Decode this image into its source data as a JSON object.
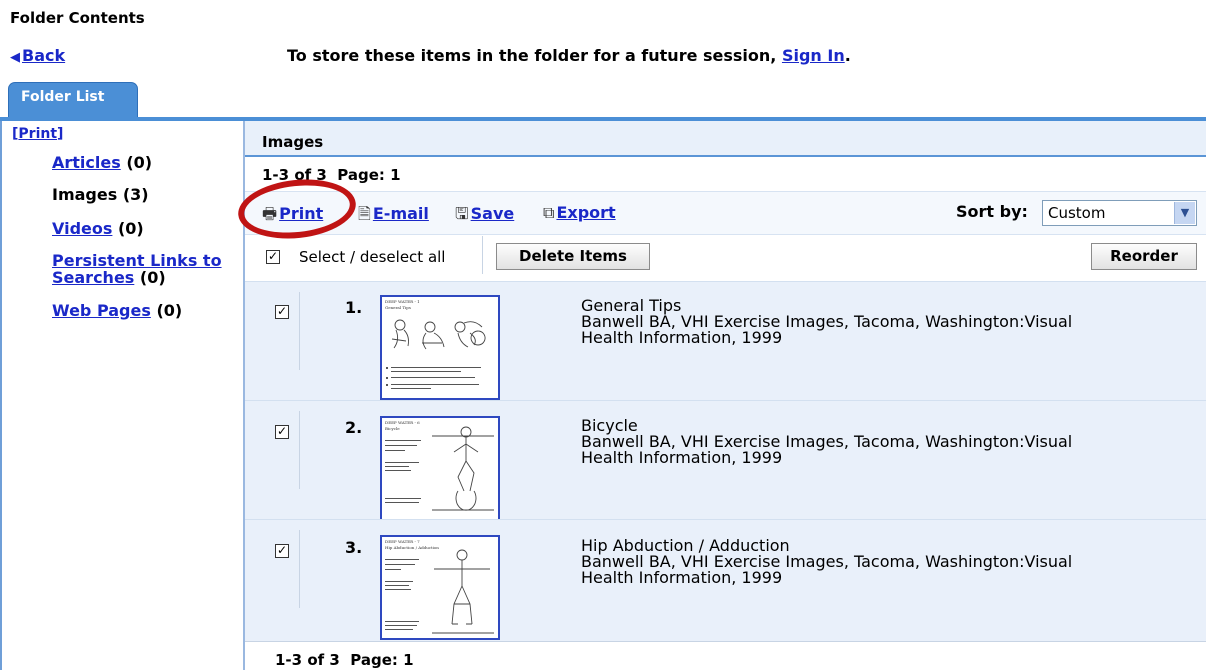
{
  "page": {
    "title": "Folder Contents",
    "back_label": "Back",
    "signin_prefix": "To store these items in the folder for a future session,",
    "signin_link": "Sign In",
    "signin_suffix": "."
  },
  "tab": {
    "label": "Folder List"
  },
  "sidebar": {
    "print_label": "Print",
    "items": [
      {
        "label": "Articles",
        "count": "(0)",
        "link": true
      },
      {
        "label": "Images",
        "count": "(3)",
        "link": false
      },
      {
        "label": "Videos",
        "count": "(0)",
        "link": true
      },
      {
        "label_line1": "Persistent Links to",
        "label_line2": "Searches",
        "count": "(0)",
        "link": true
      },
      {
        "label": "Web Pages",
        "count": "(0)",
        "link": true
      }
    ]
  },
  "main": {
    "header": "Images",
    "pager_range": "1-3 of 3",
    "pager_page": "Page: 1",
    "toolbar": {
      "print": "Print",
      "email": "E-mail",
      "save": "Save",
      "export": "Export",
      "sort_label": "Sort by:",
      "sort_value": "Custom"
    },
    "select_all_label": "Select / deselect all",
    "delete_button": "Delete Items",
    "reorder_button": "Reorder",
    "results": [
      {
        "number": "1.",
        "title": "General Tips",
        "citation_line1": "Banwell BA, VHI Exercise Images, Tacoma, Washington:Visual",
        "citation_line2": "Health Information, 1999",
        "thumb_header": "DEEP WATER - 1",
        "thumb_sub": "General Tips"
      },
      {
        "number": "2.",
        "title": "Bicycle",
        "citation_line1": "Banwell BA, VHI Exercise Images, Tacoma, Washington:Visual",
        "citation_line2": "Health Information, 1999",
        "thumb_header": "DEEP WATER - 6",
        "thumb_sub": "Bicycle"
      },
      {
        "number": "3.",
        "title": "Hip Abduction / Adduction",
        "citation_line1": "Banwell BA, VHI Exercise Images, Tacoma, Washington:Visual",
        "citation_line2": "Health Information, 1999",
        "thumb_header": "DEEP WATER - 7",
        "thumb_sub": "Hip Abduction / Adduction"
      }
    ]
  },
  "colors": {
    "link": "#1a28c8",
    "tab": "#4b8fd6",
    "row_bg": "#e9f0fa",
    "highlight": "#c01414"
  }
}
